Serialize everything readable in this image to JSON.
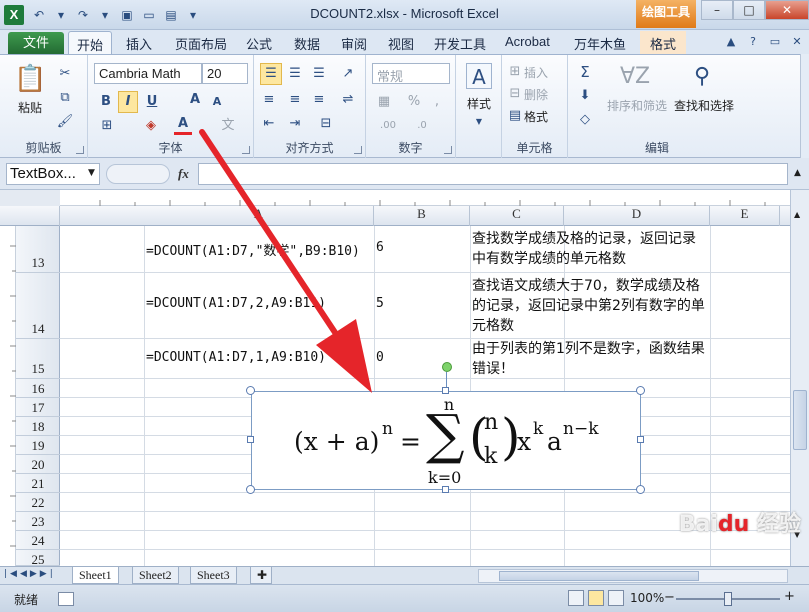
{
  "window": {
    "title": "DCOUNT2.xlsx - Microsoft Excel",
    "context_tab_header": "绘图工具",
    "app_logo": "X"
  },
  "tabs": {
    "file": "文件",
    "items": [
      "开始",
      "插入",
      "页面布局",
      "公式",
      "数据",
      "审阅",
      "视图",
      "开发工具",
      "Acrobat",
      "万年木鱼"
    ],
    "context": "格式",
    "active": "开始"
  },
  "ribbon": {
    "clipboard": {
      "paste": "粘贴",
      "label": "剪贴板"
    },
    "font": {
      "name": "Cambria Math",
      "size": "20",
      "label": "字体",
      "bold": "B",
      "italic": "I",
      "underline": "U"
    },
    "alignment": {
      "label": "对齐方式"
    },
    "number": {
      "format": "常规",
      "label": "数字"
    },
    "styles": {
      "button": "样式"
    },
    "cells": {
      "insert": "插入",
      "delete": "删除",
      "format": "格式",
      "label": "单元格"
    },
    "editing": {
      "sort_filter": "排序和筛选",
      "find_select": "查找和选择",
      "label": "编辑"
    },
    "accent": "#1e7b3c"
  },
  "formula_bar": {
    "name_box": "TextBox...",
    "fx_label": "fx",
    "value": ""
  },
  "grid": {
    "columns": [
      "A",
      "B",
      "C",
      "D",
      "E"
    ],
    "rows": [
      {
        "num": "13",
        "a": "=DCOUNT(A1:D7,\"数学\",B9:B10)",
        "b": "6",
        "c": "查找数学成绩及格的记录，返回记录中有数学成绩的单元格数"
      },
      {
        "num": "14",
        "a": "=DCOUNT(A1:D7,2,A9:B11)",
        "b": "5",
        "c": "查找语文成绩大于70，数学成绩及格的记录，返回记录中第2列有数字的单元格数"
      },
      {
        "num": "15",
        "a": "=DCOUNT(A1:D7,1,A9:B10)",
        "b": "0",
        "c": "由于列表的第1列不是数字，函数结果错误！"
      },
      {
        "num": "16"
      },
      {
        "num": "17"
      },
      {
        "num": "18"
      },
      {
        "num": "19"
      },
      {
        "num": "20"
      },
      {
        "num": "21"
      },
      {
        "num": "22"
      },
      {
        "num": "23"
      },
      {
        "num": "24"
      },
      {
        "num": "25"
      }
    ]
  },
  "equation": {
    "lhs": "(x + a)",
    "lhs_exp": "n",
    "equals": "=",
    "sum_top": "n",
    "sum_bottom": "k=0",
    "binom_top": "n",
    "binom_bottom": "k",
    "term1": "x",
    "term1_exp": "k",
    "term2": "a",
    "term2_exp": "n−k"
  },
  "sheets": {
    "tabs": [
      "Sheet1",
      "Sheet2",
      "Sheet3"
    ],
    "active": "Sheet1"
  },
  "status": {
    "ready": "就绪",
    "zoom": "100%"
  },
  "annotation": {
    "arrow_color": "#e5252a"
  },
  "watermark": "Baidu 经验"
}
